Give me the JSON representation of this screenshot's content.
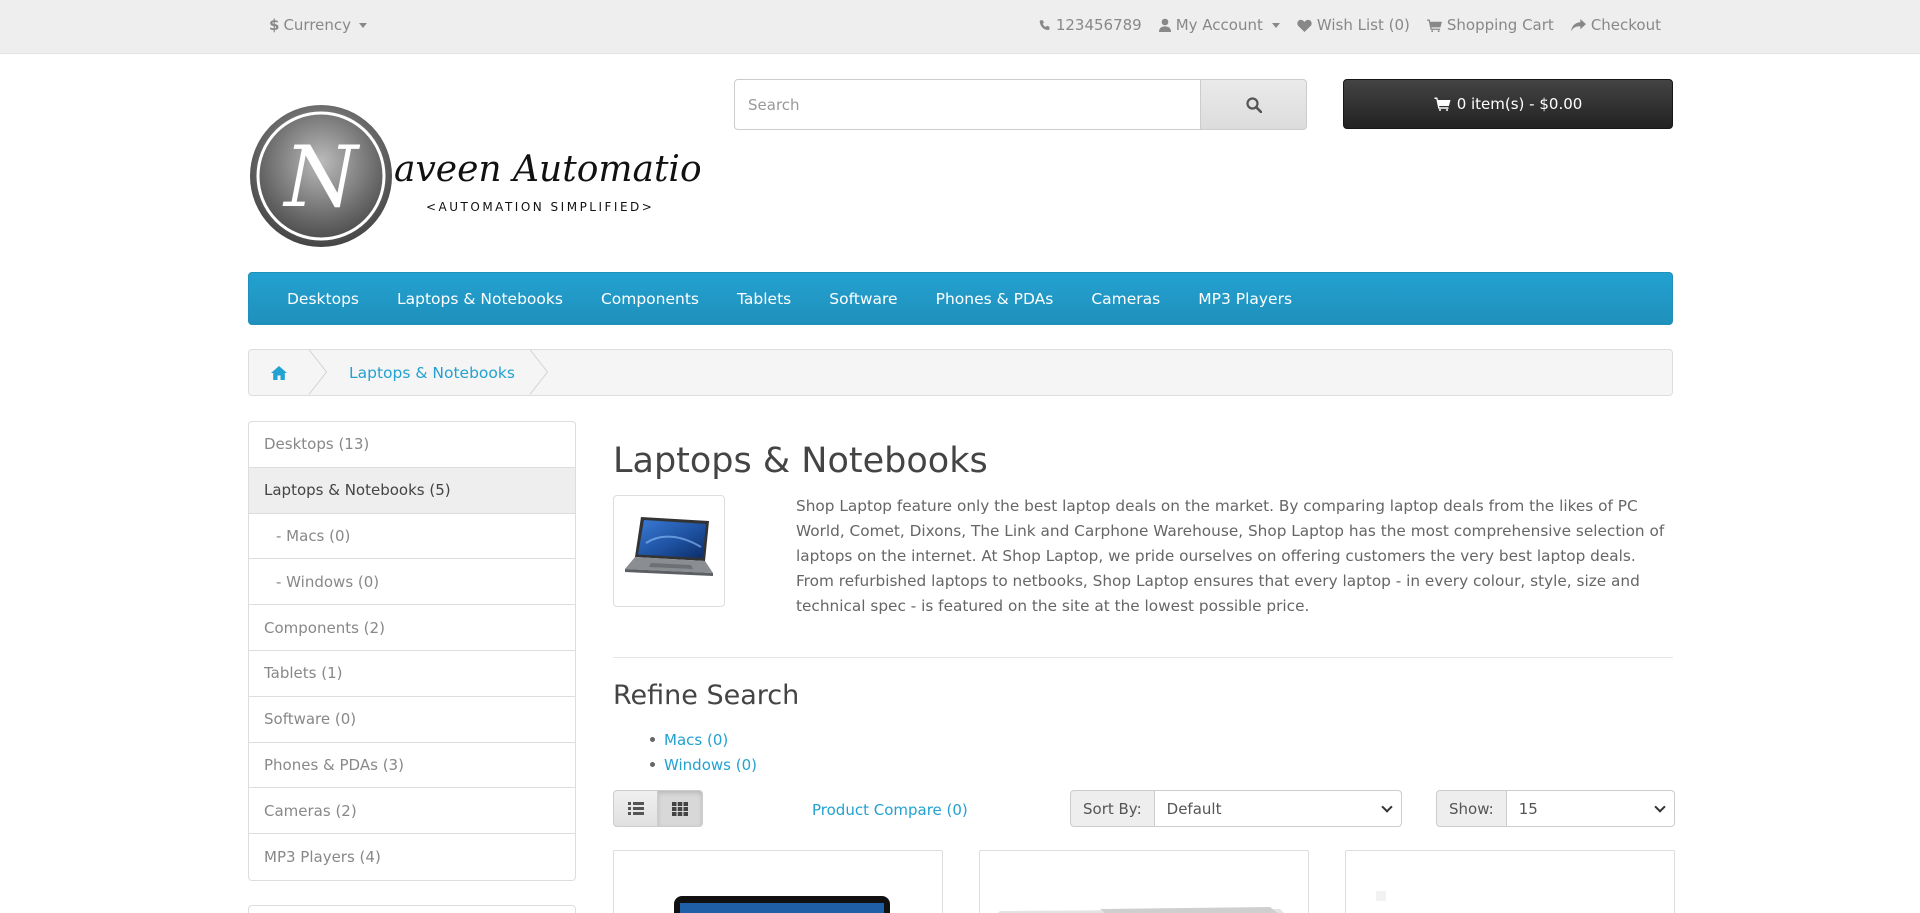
{
  "topbar": {
    "currency_label": "Currency",
    "phone": "123456789",
    "my_account": "My Account",
    "wish_list": "Wish List (0)",
    "shopping_cart": "Shopping Cart",
    "checkout": "Checkout"
  },
  "logo": {
    "letter": "N",
    "name": "aveen Automation Labs",
    "tagline": "<AUTOMATION SIMPLIFIED>"
  },
  "search": {
    "placeholder": "Search"
  },
  "cart": {
    "label": "0 item(s) - $0.00"
  },
  "menu": [
    "Desktops",
    "Laptops & Notebooks",
    "Components",
    "Tablets",
    "Software",
    "Phones & PDAs",
    "Cameras",
    "MP3 Players"
  ],
  "breadcrumb": {
    "current": "Laptops & Notebooks"
  },
  "sidebar": [
    {
      "label": "Desktops (13)"
    },
    {
      "label": "Laptops & Notebooks (5)"
    },
    {
      "label": "- Macs (0)"
    },
    {
      "label": "- Windows (0)"
    },
    {
      "label": "Components (2)"
    },
    {
      "label": "Tablets (1)"
    },
    {
      "label": "Software (0)"
    },
    {
      "label": "Phones & PDAs (3)"
    },
    {
      "label": "Cameras (2)"
    },
    {
      "label": "MP3 Players (4)"
    }
  ],
  "category": {
    "title": "Laptops & Notebooks",
    "description": "Shop Laptop feature only the best laptop deals on the market. By comparing laptop deals from the likes of PC World, Comet, Dixons, The Link and Carphone Warehouse, Shop Laptop has the most comprehensive selection of laptops on the internet. At Shop Laptop, we pride ourselves on offering customers the very best laptop deals. From refurbished laptops to netbooks, Shop Laptop ensures that every laptop - in every colour, style, size and technical spec - is featured on the site at the lowest possible price."
  },
  "refine": {
    "title": "Refine Search",
    "links": [
      "Macs (0)",
      "Windows (0)"
    ]
  },
  "toolbar": {
    "compare": "Product Compare (0)",
    "sort_label": "Sort By:",
    "sort_value": "Default",
    "show_label": "Show:",
    "show_value": "15"
  },
  "colors": {
    "accent": "#23a1d1",
    "cart_bg": "#222222"
  }
}
